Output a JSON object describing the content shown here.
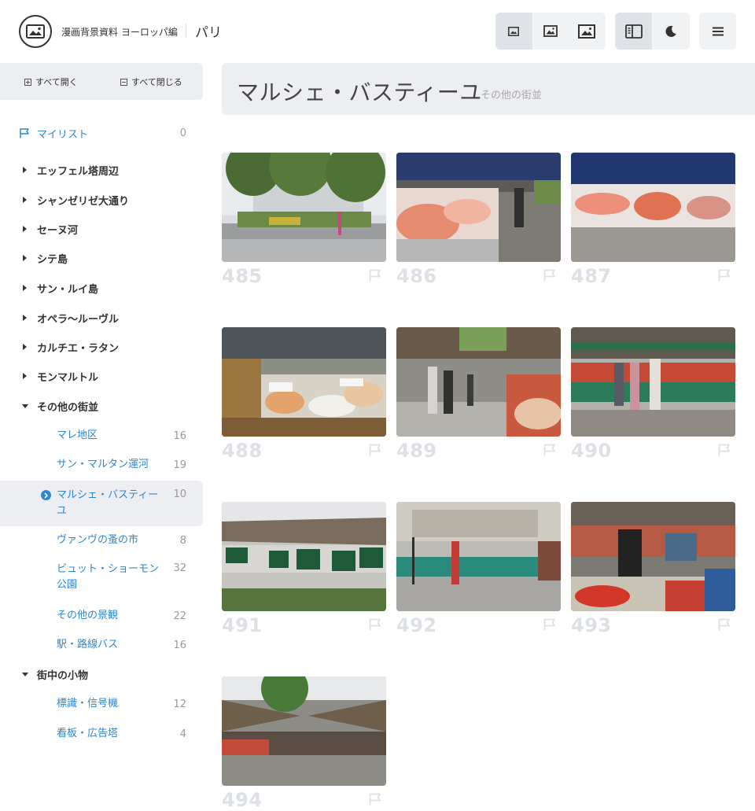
{
  "header": {
    "site_title": "漫画背景資料 ヨーロッパ編",
    "city": "パリ"
  },
  "sidebar": {
    "expand_all": "すべて開く",
    "collapse_all": "すべて閉じる",
    "mylist": {
      "label": "マイリスト",
      "count": "0"
    },
    "sections": [
      "エッフェル塔周辺",
      "シャンゼリゼ大通り",
      "セーヌ河",
      "シテ島",
      "サン・ルイ島",
      "オペラ〜ルーヴル",
      "カルチエ・ラタン",
      "モンマルトル"
    ],
    "open_section": "その他の街並",
    "sub_items": [
      {
        "label": "マレ地区",
        "count": "16"
      },
      {
        "label": "サン・マルタン運河",
        "count": "19"
      },
      {
        "label": "マルシェ・バスティー",
        "label2": "ユ",
        "count": "10"
      },
      {
        "label": "ヴァンヴの蚤の市",
        "count": "8"
      },
      {
        "label": "ビュット・ショーモン",
        "label2": "公園",
        "count": "32"
      },
      {
        "label": "その他の景観",
        "count": "22"
      },
      {
        "label": "駅・路線バス",
        "count": "16"
      }
    ],
    "open_section2": "街中の小物",
    "sub_items2": [
      {
        "label": "標識・信号機",
        "count": "12"
      },
      {
        "label": "看板・広告塔",
        "count": "4"
      }
    ]
  },
  "main": {
    "title": "マルシェ・バスティーユ",
    "subtitle": "その他の街並",
    "photos": [
      "485",
      "486",
      "487",
      "488",
      "489",
      "490",
      "491",
      "492",
      "493",
      "494"
    ]
  },
  "colors": {
    "accent": "#2b87d1",
    "panel": "#eceef1",
    "number": "#dde0e4"
  }
}
